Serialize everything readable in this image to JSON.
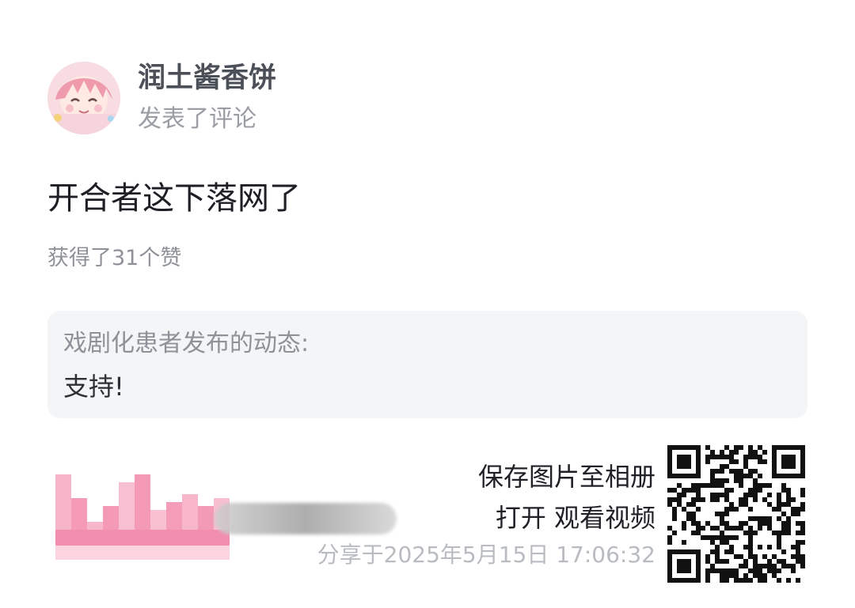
{
  "user": {
    "name": "润土酱香饼",
    "action": "发表了评论"
  },
  "comment": {
    "text": "开合者这下落网了",
    "likes": "获得了31个赞"
  },
  "quote": {
    "author": "戏剧化患者发布的动态:",
    "body": "支持!"
  },
  "footer": {
    "save_hint": "保存图片至相册",
    "open_hint": "打开 观看视频",
    "share_time": "分享于2025年5月15日 17:06:32"
  },
  "icons": {
    "avatar": "avatar-image",
    "logo": "pixelated-logo",
    "qr": "qr-code"
  },
  "colors": {
    "quote_background": "#f4f5f7",
    "secondary_text": "#8e9197",
    "logo_pink": "#f3a4bf"
  }
}
